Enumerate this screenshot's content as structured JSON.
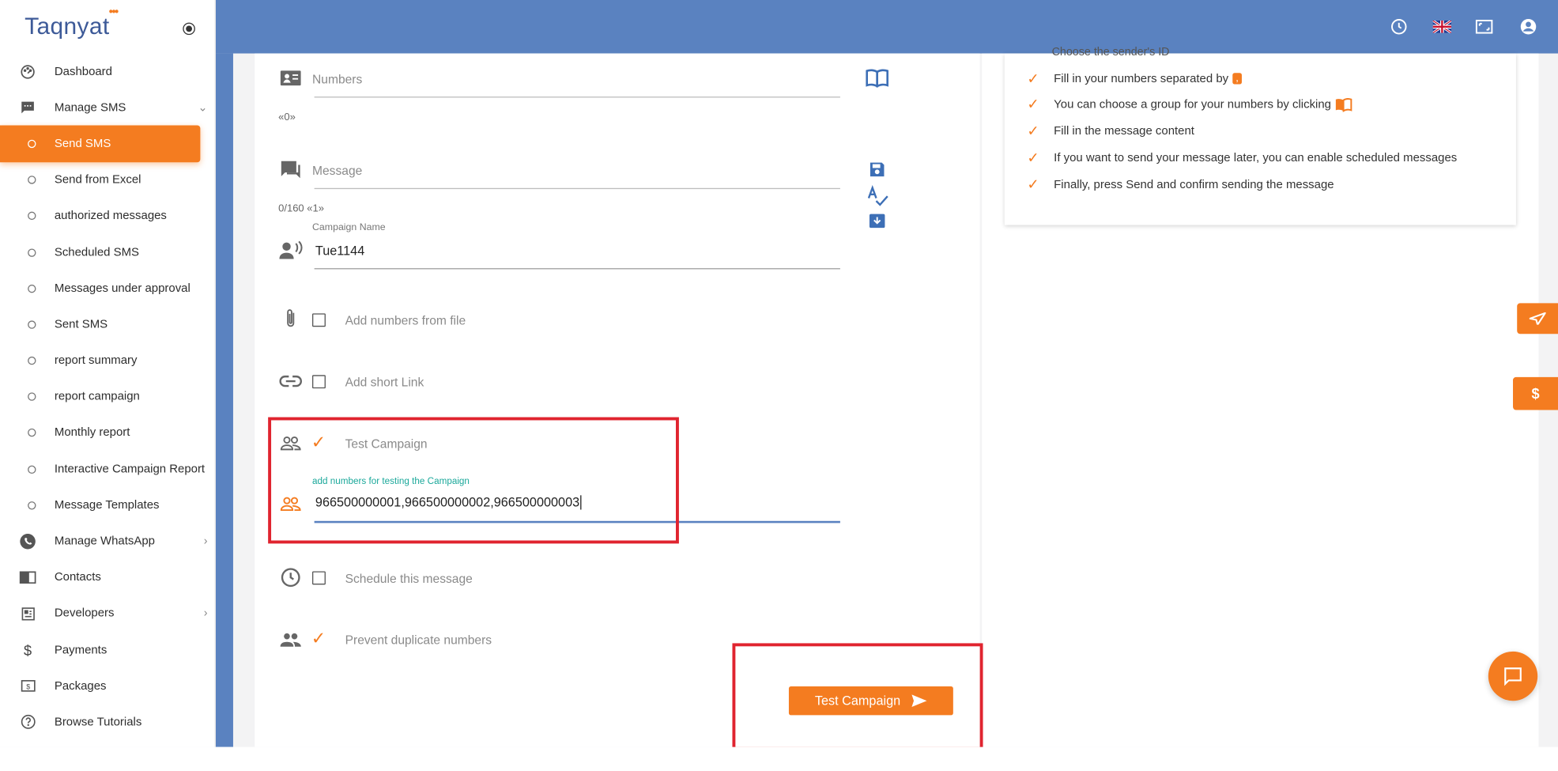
{
  "brand": {
    "name": "Taqnyat",
    "dots": "•••"
  },
  "colors": {
    "accent": "#f47c20",
    "topbar": "#5a82c0",
    "highlight_box": "#e0242f",
    "link_teal": "#1aa89a"
  },
  "topbar": {
    "icons": [
      "clock-icon",
      "uk-flag-icon",
      "fullscreen-icon",
      "account-icon"
    ]
  },
  "sidebar": {
    "items": [
      {
        "label": "Dashboard",
        "icon": "dashboard-icon"
      },
      {
        "label": "Manage SMS",
        "icon": "sms-icon",
        "expanded": true
      },
      {
        "label": "Send SMS",
        "active": true
      },
      {
        "label": "Send from Excel"
      },
      {
        "label": "authorized messages"
      },
      {
        "label": "Scheduled SMS"
      },
      {
        "label": "Messages under approval"
      },
      {
        "label": "Sent SMS"
      },
      {
        "label": "report summary"
      },
      {
        "label": "report campaign"
      },
      {
        "label": "Monthly report"
      },
      {
        "label": "Interactive Campaign Report"
      },
      {
        "label": "Message Templates"
      },
      {
        "label": "Manage WhatsApp",
        "icon": "whatsapp-icon"
      },
      {
        "label": "Contacts",
        "icon": "contacts-book-icon"
      },
      {
        "label": "Developers",
        "icon": "developers-icon"
      },
      {
        "label": "Payments",
        "icon": "dollar-icon"
      },
      {
        "label": "Packages",
        "icon": "package-icon"
      },
      {
        "label": "Browse Tutorials",
        "icon": "help-icon"
      }
    ]
  },
  "form": {
    "numbers_placeholder": "Numbers",
    "numbers_counter": "«0»",
    "message_placeholder": "Message",
    "message_counter": "0/160 «1»",
    "campaign_name_label": "Campaign Name",
    "campaign_name_value": "Tue1144",
    "add_from_file_label": "Add numbers from file",
    "add_from_file_checked": false,
    "short_link_label": "Add short Link",
    "short_link_checked": false,
    "test_campaign_label": "Test Campaign",
    "test_campaign_checked": true,
    "test_numbers_label": "add numbers for testing the Campaign",
    "test_numbers_value": "966500000001,966500000002,966500000003",
    "schedule_label": "Schedule this message",
    "schedule_checked": false,
    "prevent_duplicates_label": "Prevent duplicate numbers",
    "prevent_duplicates_checked": true,
    "submit_label": "Test Campaign"
  },
  "instructions": {
    "partial_heading": "Choose the sender's ID",
    "steps": [
      "Fill in your numbers separated by",
      "You can choose a group for your numbers by clicking",
      "Fill in the message content",
      "If you want to send your message later, you can enable scheduled messages",
      "Finally, press Send and confirm sending the message"
    ],
    "separator_glyph": ","
  },
  "side_tabs": [
    "send-icon",
    "$"
  ]
}
